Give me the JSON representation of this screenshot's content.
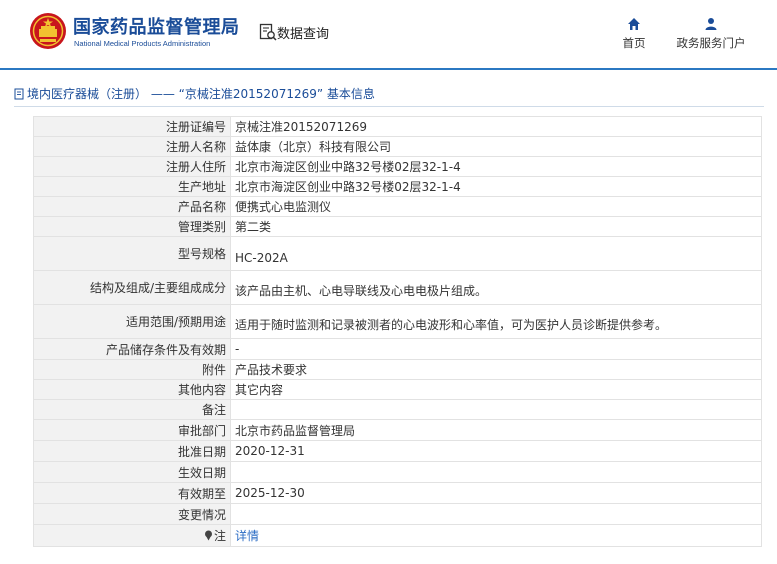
{
  "header": {
    "agency_cn": "国家药品监督管理局",
    "agency_en": "National Medical Products Administration",
    "query_label": "数据查询",
    "nav": [
      {
        "label": "首页",
        "icon": "home-icon"
      },
      {
        "label": "政务服务门户",
        "icon": "user-icon"
      }
    ]
  },
  "section": {
    "category": "境内医疗器械（注册）",
    "dash": "——",
    "title": "“京械注准20152071269” 基本信息"
  },
  "record": {
    "rows": [
      {
        "label": "注册证编号",
        "value": "京械注准20152071269"
      },
      {
        "label": "注册人名称",
        "value": "益体康（北京）科技有限公司"
      },
      {
        "label": "注册人住所",
        "value": "北京市海淀区创业中路32号楼02层32-1-4"
      },
      {
        "label": "生产地址",
        "value": "北京市海淀区创业中路32号楼02层32-1-4"
      },
      {
        "label": "产品名称",
        "value": "便携式心电监测仪"
      },
      {
        "label": "管理类别",
        "value": "第二类"
      },
      {
        "label": "型号规格",
        "value": "HC-202A"
      },
      {
        "label": "结构及组成/主要组成成分",
        "value": "该产品由主机、心电导联线及心电电极片组成。"
      },
      {
        "label": "适用范围/预期用途",
        "value": "适用于随时监测和记录被测者的心电波形和心率值，可为医护人员诊断提供参考。"
      },
      {
        "label": "产品储存条件及有效期",
        "value": "-"
      },
      {
        "label": "附件",
        "value": "产品技术要求"
      },
      {
        "label": "其他内容",
        "value": "其它内容"
      },
      {
        "label": "备注",
        "value": ""
      },
      {
        "label": "审批部门",
        "value": "北京市药品监督管理局"
      },
      {
        "label": "批准日期",
        "value": "2020-12-31"
      },
      {
        "label": "生效日期",
        "value": ""
      },
      {
        "label": "有效期至",
        "value": "2025-12-30"
      },
      {
        "label": "变更情况",
        "value": ""
      },
      {
        "label": "注",
        "value": "详情"
      }
    ]
  },
  "colors": {
    "brand_blue": "#1a4c98",
    "link_blue": "#2b6cc4",
    "label_bg": "#f2f2f2"
  }
}
